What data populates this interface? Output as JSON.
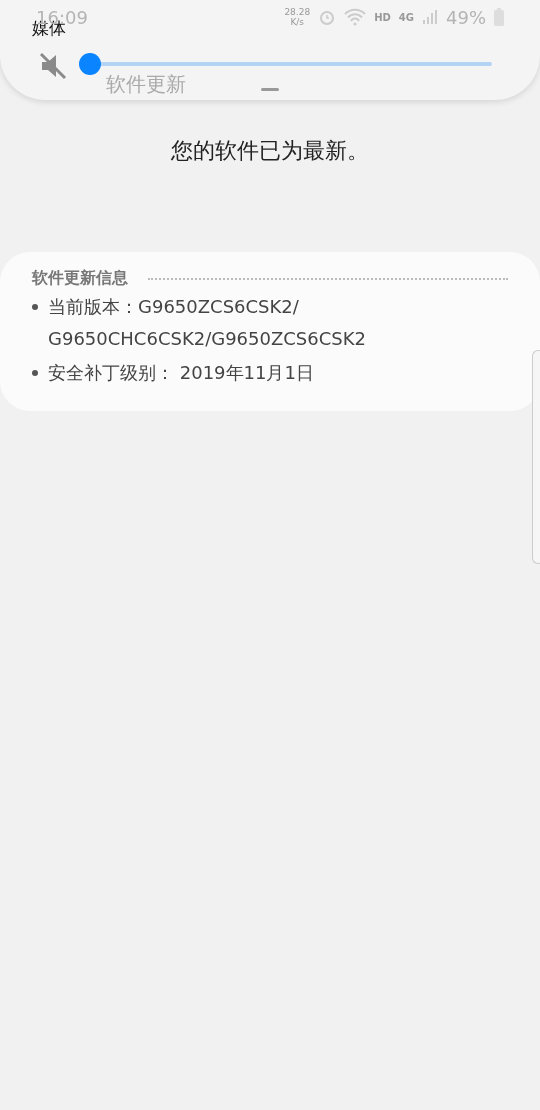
{
  "status_bar": {
    "time": "16:09",
    "speed": "28.28",
    "speed_unit": "K/s",
    "hd": "HD",
    "network": "4G",
    "battery": "49%"
  },
  "header": {
    "title": "软件更新"
  },
  "volume_panel": {
    "label": "媒体",
    "muted": true,
    "level": 0
  },
  "message": "您的软件已为最新。",
  "info_card": {
    "title": "软件更新信息",
    "items": [
      "当前版本：G9650ZCS6CSK2/ G9650CHC6CSK2/G9650ZCS6CSK2",
      "安全补丁级别： 2019年11月1日"
    ]
  }
}
